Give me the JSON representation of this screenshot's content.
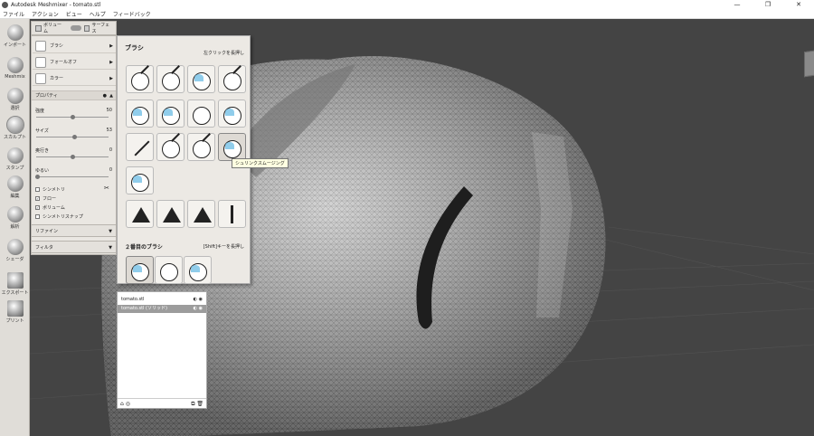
{
  "window": {
    "title": "Autodesk Meshmixer - tomato.stl",
    "minimize": "—",
    "restore": "❐",
    "close": "✕"
  },
  "menu": [
    "ファイル",
    "アクション",
    "ビュー",
    "ヘルプ",
    "フィードバック"
  ],
  "toolbar": [
    {
      "label": "インポート",
      "icon": "import-icon"
    },
    {
      "label": "Meshmix",
      "icon": "meshmix-icon"
    },
    {
      "label": "選択",
      "icon": "select-icon"
    },
    {
      "label": "スカルプト",
      "icon": "sculpt-icon",
      "active": true
    },
    {
      "label": "スタンプ",
      "icon": "stamp-icon"
    },
    {
      "label": "編集",
      "icon": "edit-icon"
    },
    {
      "label": "解析",
      "icon": "analysis-icon"
    },
    {
      "label": "シェーダ",
      "icon": "shader-icon"
    },
    {
      "label": "エクスポート",
      "icon": "export-icon"
    },
    {
      "label": "プリント",
      "icon": "print-icon"
    }
  ],
  "sculpt": {
    "mode": {
      "volume": "ボリューム",
      "surface": "サーフェス"
    },
    "rows": [
      {
        "label": "ブラシ",
        "icon": "brush-thumb-icon"
      },
      {
        "label": "フォールオフ",
        "icon": "falloff-thumb-icon"
      },
      {
        "label": "カラー",
        "icon": "color-thumb-icon"
      }
    ],
    "properties_title": "プロパティ",
    "properties": [
      {
        "label": "強度",
        "value": "50",
        "level": 0.5
      },
      {
        "label": "サイズ",
        "value": "53",
        "level": 0.53
      },
      {
        "label": "奥行き",
        "value": "0",
        "level": 0.5
      },
      {
        "label": "ゆるい",
        "value": "0",
        "level": 0.0
      }
    ],
    "checks": [
      {
        "label": "シンメトリ",
        "checked": false
      },
      {
        "label": "フロー",
        "checked": true
      },
      {
        "label": "ボリューム",
        "checked": true
      },
      {
        "label": "シンメトリスナップ",
        "checked": false
      }
    ],
    "refine": "リファイン",
    "filter": "フィルタ"
  },
  "brushes": {
    "title": "ブラシ",
    "hint": "左クリックを長押し",
    "tooltip": "シュリンクスムージング",
    "second_title": "２番目のブラシ",
    "second_hint": "[Shift]キーを長押し"
  },
  "objects": [
    {
      "name": "tomato.stl",
      "selected": false
    },
    {
      "name": "tomato.stl (ソリッド)",
      "selected": true
    }
  ],
  "objects_footer": {
    "left": "⌂ ◎",
    "right": "⧉ 🗑"
  },
  "viewcube": "右"
}
